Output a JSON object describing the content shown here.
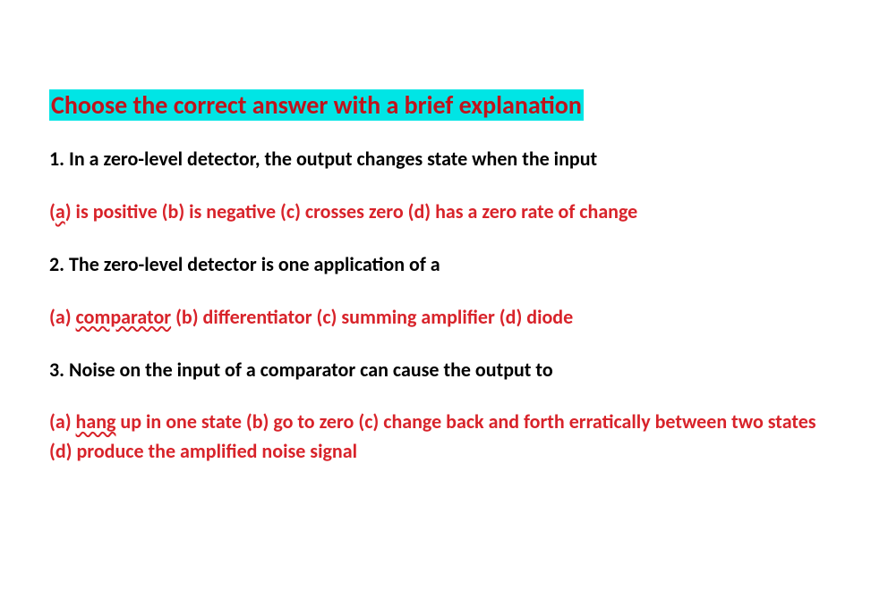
{
  "heading": "Choose the correct answer with a brief explanation",
  "questions": {
    "q1": {
      "text": "1. In a zero-level detector, the output changes state when the input",
      "opt_a_prefix": " (",
      "opt_a_letter": "a",
      "opt_a_suffix": ") is positive (b) is negative (c) crosses zero (d) has a zero rate of change"
    },
    "q2": {
      "text": "2. The zero-level detector is one application of a",
      "opt_prefix": " (a) ",
      "opt_word": "comparator",
      "opt_suffix": " (b) differentiator (c) summing amplifier (d) diode"
    },
    "q3": {
      "text": "3. Noise on the input of a comparator can cause the output to",
      "opt_prefix": "(a) ",
      "opt_word": "hang",
      "opt_suffix": " up in one state (b) go to zero (c) change back and forth erratically between two states  (d) produce the amplified noise signal"
    }
  }
}
